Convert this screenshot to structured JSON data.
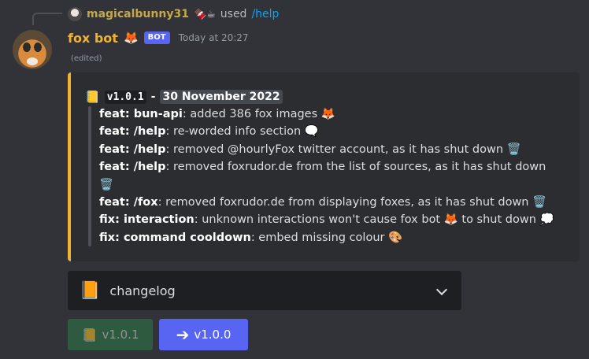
{
  "interaction": {
    "username": "magicalbunny31",
    "emojis": "🍫☕",
    "used_text": "used",
    "command": "/help"
  },
  "message": {
    "author": "fox bot",
    "author_emoji": "🦊",
    "bot_tag": "BOT",
    "timestamp": "Today at 20:27",
    "edited": "(edited)"
  },
  "embed": {
    "accent_color": "#f0b232",
    "title_emoji": "📒",
    "version_code": "v1.0.1",
    "separator": "-",
    "date": "30 November 2022",
    "lines": [
      {
        "tag": "feat: bun-api",
        "text": ": added 386 fox images 🦊"
      },
      {
        "tag": "feat: /help",
        "text": ": re-worded info section 🗨️"
      },
      {
        "tag": "feat: /help",
        "text": ": removed @hourlyFox twitter account, as it has shut down 🗑️"
      },
      {
        "tag": "feat: /help",
        "text": ": removed foxrudor.de from the list of sources, as it has shut down"
      },
      {
        "tag": "",
        "text": "🗑️"
      },
      {
        "tag": "feat: /fox",
        "text": ": removed foxrudor.de from displaying foxes, as it has shut down 🗑️"
      },
      {
        "tag": "fix: interaction",
        "text": ": unknown interactions won't cause fox bot 🦊 to shut down 💭"
      },
      {
        "tag": "fix: command cooldown",
        "text": ": embed missing colour 🎨"
      }
    ]
  },
  "select_menu": {
    "icon": "📙",
    "label": "changelog"
  },
  "buttons": {
    "prev_emoji": "📒",
    "prev_label": "v1.0.1",
    "next_icon": "➔",
    "next_label": "v1.0.0",
    "prev_color": "#2d7d46",
    "next_color": "#5865f2"
  }
}
